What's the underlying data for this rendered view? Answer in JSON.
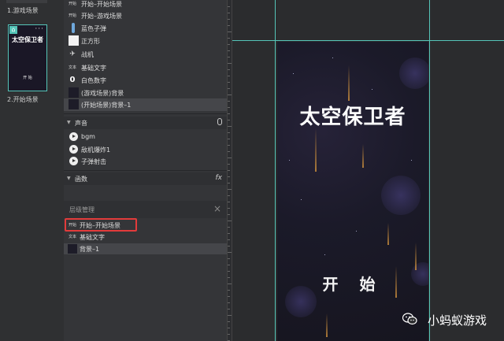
{
  "scenes": [
    {
      "label": "1.游戏场景"
    },
    {
      "label": "2.开始场景",
      "thumb_title": "太空保卫者",
      "thumb_start": "开 始"
    }
  ],
  "assets": [
    {
      "icon": "开始",
      "label": "开始–开始场景",
      "icon_name": "scene-icon"
    },
    {
      "icon": "开始",
      "label": "开始–游戏场景",
      "icon_name": "scene-icon"
    },
    {
      "icon": "",
      "label": "蓝色子弹",
      "icon_name": "bullet-icon"
    },
    {
      "icon": "",
      "label": "正方形",
      "icon_name": "square-icon"
    },
    {
      "icon": "✈",
      "label": "战机",
      "icon_name": "plane-icon"
    },
    {
      "icon": "文本",
      "label": "基础文字",
      "icon_name": "text-icon"
    },
    {
      "icon": "0",
      "label": "白色数字",
      "icon_name": "digit-icon"
    },
    {
      "icon": "",
      "label": "(游戏场景)背景",
      "icon_name": "image-icon"
    },
    {
      "icon": "",
      "label": "(开始场景)背景–1",
      "icon_name": "image-icon"
    }
  ],
  "sound_section": {
    "title": "声音",
    "items": [
      {
        "label": "bgm"
      },
      {
        "label": "敌机爆炸1"
      },
      {
        "label": "子弹射击"
      }
    ]
  },
  "function_section": {
    "title": "函数",
    "fx": "fx"
  },
  "hierarchy": {
    "title": "层级管理",
    "close": "×",
    "items": [
      {
        "icon": "开始",
        "label": "开始–开始场景"
      },
      {
        "icon": "文本",
        "label": "基础文字"
      },
      {
        "icon": "",
        "label": "背景–1"
      }
    ]
  },
  "game": {
    "title": "太空保卫者",
    "start": "开 始"
  },
  "watermark": "小蚂蚁游戏",
  "colors": {
    "accent": "#55c5b8",
    "highlight": "#e23b3b"
  }
}
